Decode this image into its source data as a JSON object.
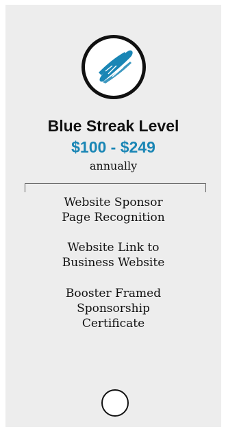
{
  "tier": {
    "logo_icon": "blue-streak-brush-icon",
    "title": "Blue Streak Level",
    "price": "$100 - $249",
    "period": "annually",
    "benefits": [
      [
        "Website Sponsor",
        "Page Recognition"
      ],
      [
        "Website Link to",
        "Business Website"
      ],
      [
        "Booster Framed",
        "Sponsorship",
        "Certificate"
      ]
    ]
  },
  "colors": {
    "card_background": "#ededed",
    "accent_blue": "#1a86b5",
    "text": "#111111"
  }
}
